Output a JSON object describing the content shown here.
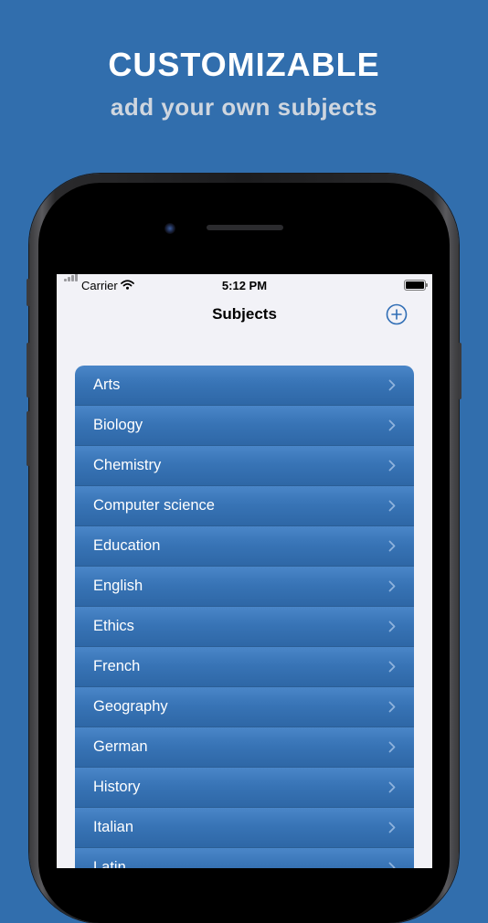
{
  "promo": {
    "headline": "CUSTOMIZABLE",
    "subheadline": "add your own subjects"
  },
  "status_bar": {
    "carrier": "Carrier",
    "time": "5:12 PM"
  },
  "nav": {
    "title": "Subjects",
    "add_icon": "plus-circle-icon"
  },
  "subjects": [
    {
      "label": "Arts"
    },
    {
      "label": "Biology"
    },
    {
      "label": "Chemistry"
    },
    {
      "label": "Computer science"
    },
    {
      "label": "Education"
    },
    {
      "label": "English"
    },
    {
      "label": "Ethics"
    },
    {
      "label": "French"
    },
    {
      "label": "Geography"
    },
    {
      "label": "German"
    },
    {
      "label": "History"
    },
    {
      "label": "Italian"
    },
    {
      "label": "Latin"
    }
  ],
  "colors": {
    "background": "#316ead",
    "row_blue": "#3874b6",
    "accent": "#2f6db5"
  }
}
